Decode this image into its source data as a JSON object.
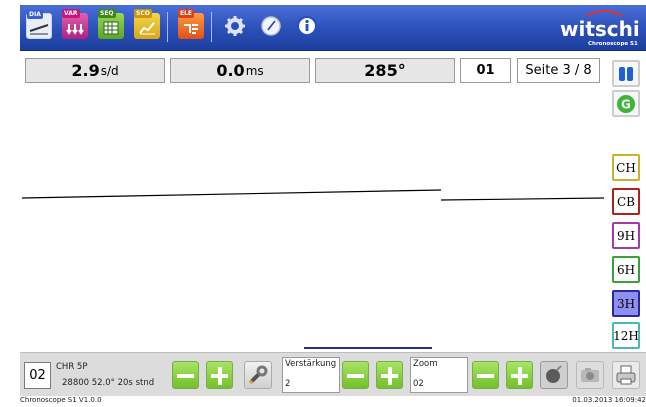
{
  "toolbar": {
    "buttons": [
      {
        "name": "diagram-icon",
        "label": "DIA"
      },
      {
        "name": "variables-icon",
        "label": "VAR"
      },
      {
        "name": "sequence-icon",
        "label": "SEQ"
      },
      {
        "name": "score-icon",
        "label": "SCO"
      },
      {
        "name": "electronics-icon",
        "label": "ELE"
      }
    ],
    "logo_text": "witschi",
    "logo_sub": "Chronoscope S1"
  },
  "stats": {
    "rate_value": "2.9",
    "rate_unit": "s/d",
    "beat_value": "0.0",
    "beat_unit": "ms",
    "amplitude": "285°",
    "position": "01",
    "page": "Seite 3 / 8"
  },
  "sidebar": {
    "positions": [
      {
        "label": "CH",
        "color": "#c9b22a"
      },
      {
        "label": "CB",
        "color": "#b02020"
      },
      {
        "label": "9H",
        "color": "#a23aa8"
      },
      {
        "label": "6H",
        "color": "#3aa03a"
      },
      {
        "label": "3H",
        "color": "#2a2aa0",
        "fill": "#8f8ff2"
      },
      {
        "label": "12H",
        "color": "#4bb8b8"
      }
    ]
  },
  "bottom": {
    "channel": "02",
    "model_line1": "CHR 5P",
    "model_line2": "28800  52.0°  20s  stnd",
    "gain_label": "Verstärkung",
    "gain_value": "2",
    "zoom_label": "Zoom",
    "zoom_value": "02"
  },
  "status": {
    "version": "Chronoscope S1 V1.0.0",
    "datetime": "01.03.2013 16:09:42"
  },
  "colors": {
    "toolbar": "#2b4fb8",
    "trace": "#000000",
    "marker": "#2a2a9e"
  }
}
